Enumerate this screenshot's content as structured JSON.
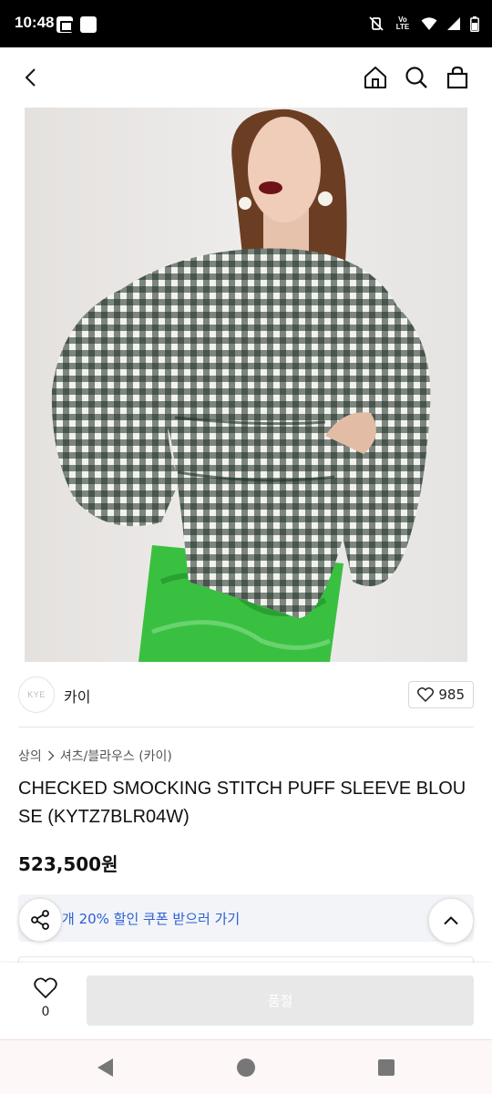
{
  "status_bar": {
    "time": "10:48",
    "network_label": "Vo LTE"
  },
  "header": {
    "back_icon": "chevron-left-icon",
    "home_icon": "home-icon",
    "search_icon": "search-icon",
    "bag_icon": "shopping-bag-icon"
  },
  "product": {
    "brand": "카이",
    "brand_logo_text": "KYE",
    "like_count": "985",
    "breadcrumb": [
      "상의",
      "셔츠/블라우스 (카이)"
    ],
    "title": "CHECKED SMOCKING STITCH PUFF SLEEVE BLOUSE (KYTZ7BLR04W)",
    "price": "523,500원"
  },
  "coupon": {
    "text": "최대 20% 할인 쿠폰 받으러 가기",
    "visible_text": "개 20% 할인 쿠폰 받으러 가기"
  },
  "bottom_bar": {
    "wish_count": "0",
    "soldout_label": "품절"
  },
  "colors": {
    "accent_blue": "#2c5fd6",
    "soldout_bg": "#e8e8e8",
    "gingham_dark": "#1c2e22",
    "skirt_green": "#39c040"
  }
}
